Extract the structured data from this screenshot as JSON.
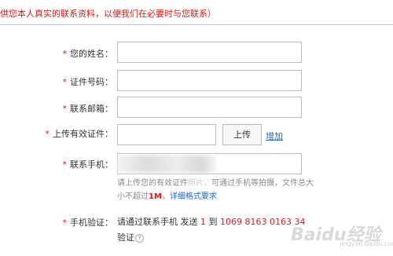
{
  "notice": "供您本人真实的联系资料，以便我们在必要时与您联系）",
  "form": {
    "required_mark": "*",
    "name_label": "您的姓名：",
    "id_label": "证件号码：",
    "email_label": "联系邮箱：",
    "upload_label": "上传有效证件：",
    "phone_label": "联系手机：",
    "verify_label": "手机验证："
  },
  "upload": {
    "button_label": "上传",
    "add_link": "增加"
  },
  "hint": {
    "part1": "请上传您的有效证件",
    "part2": "照片，",
    "part3": "可通过手机等拍摄，文件总大小不超过",
    "size": "1M",
    "sep": "，",
    "format_link": "详细格式要求"
  },
  "verify": {
    "part1": "请通过联系手机 发送",
    "code": "1",
    "to": "到",
    "number": "1069 8163 0163 34",
    "part2": "验证",
    "help_glyph": "?"
  },
  "watermark": {
    "text": "Baidu经验",
    "sub": "jingyan.baidu.com"
  }
}
